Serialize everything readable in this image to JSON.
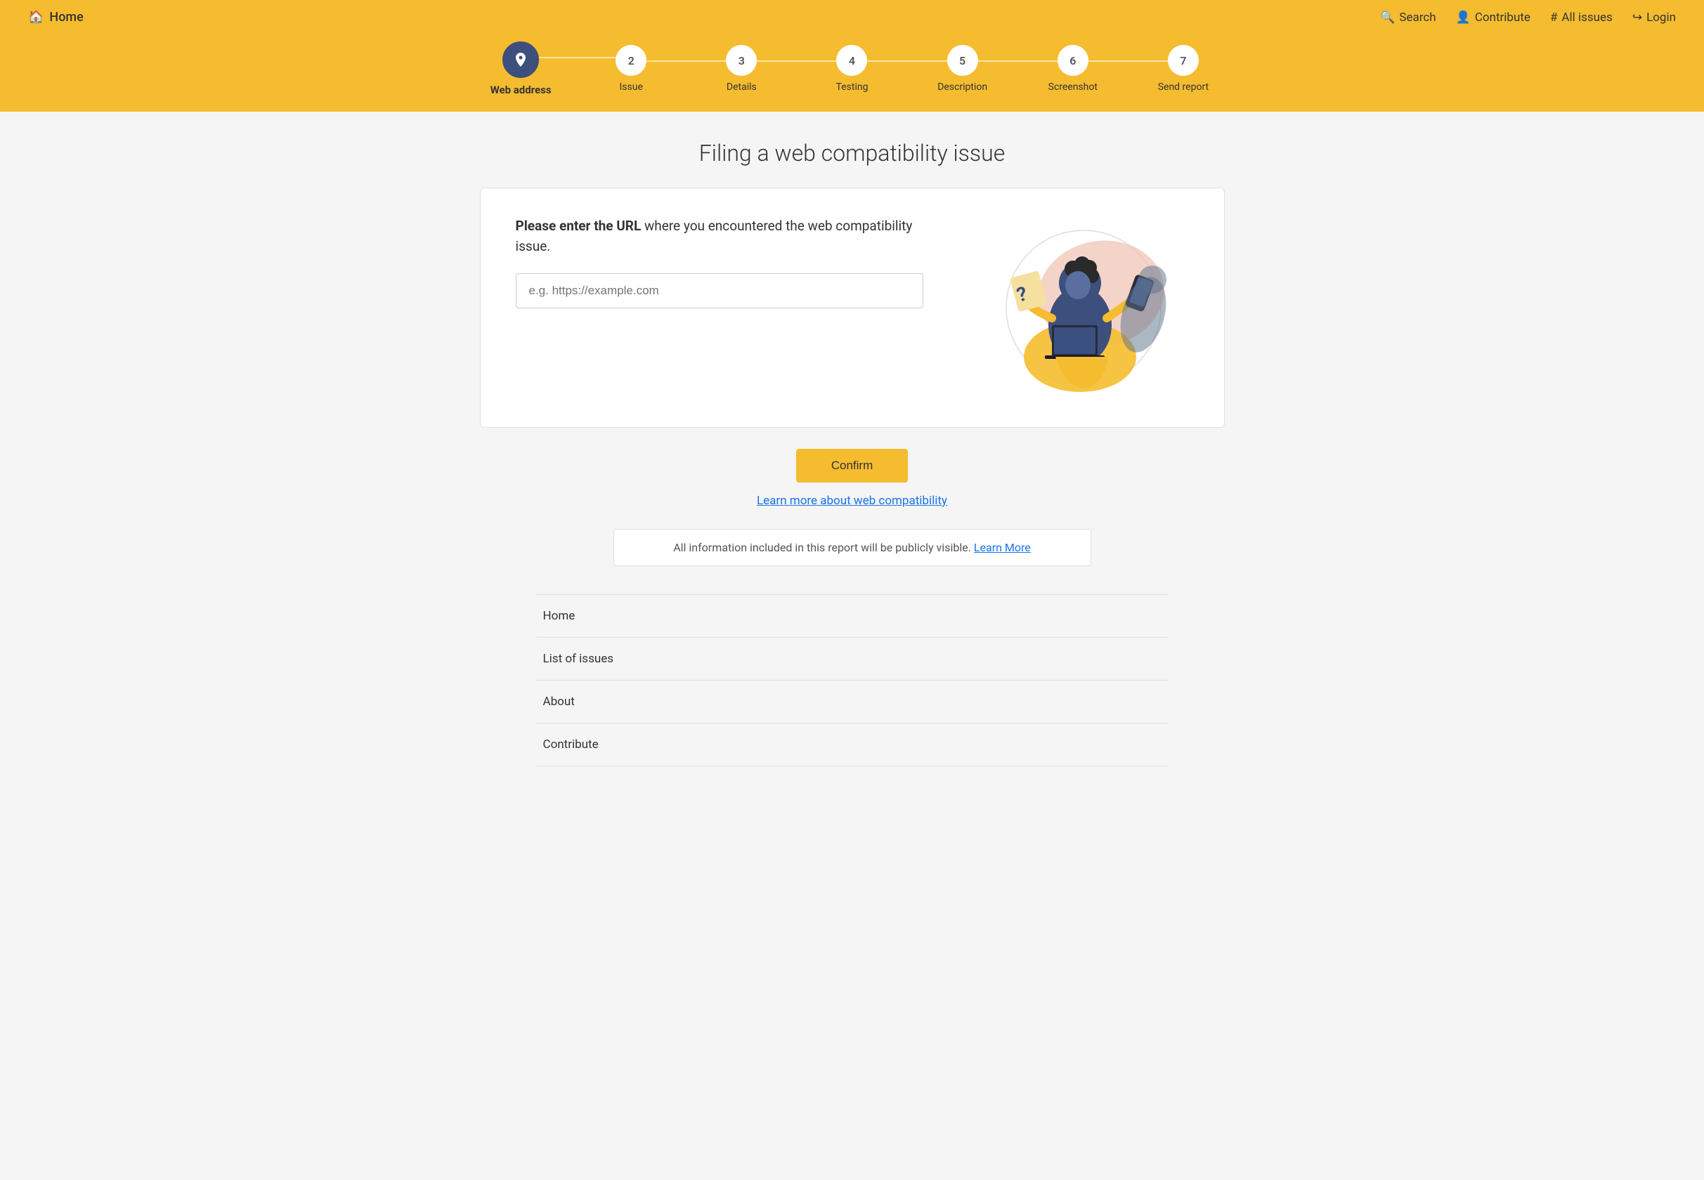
{
  "header": {
    "home_label": "Home",
    "home_icon": "🏠",
    "nav": [
      {
        "id": "search",
        "label": "Search",
        "icon": "🔍"
      },
      {
        "id": "contribute",
        "label": "Contribute",
        "icon": "👤"
      },
      {
        "id": "all_issues",
        "label": "All issues",
        "icon": "#"
      },
      {
        "id": "login",
        "label": "Login",
        "icon": "→"
      }
    ]
  },
  "stepper": {
    "steps": [
      {
        "id": "web-address",
        "number": "1",
        "label": "Web address",
        "active": true,
        "icon": "📍"
      },
      {
        "id": "issue",
        "number": "2",
        "label": "Issue",
        "active": false
      },
      {
        "id": "details",
        "number": "3",
        "label": "Details",
        "active": false
      },
      {
        "id": "testing",
        "number": "4",
        "label": "Testing",
        "active": false
      },
      {
        "id": "description",
        "number": "5",
        "label": "Description",
        "active": false
      },
      {
        "id": "screenshot",
        "number": "6",
        "label": "Screenshot",
        "active": false
      },
      {
        "id": "send-report",
        "number": "7",
        "label": "Send report",
        "active": false
      }
    ]
  },
  "main": {
    "page_title": "Filing a web compatibility issue",
    "card": {
      "prompt_bold": "Please enter the URL",
      "prompt_rest": " where you encountered the web compatibility issue.",
      "input_placeholder": "e.g. https://example.com"
    },
    "confirm_label": "Confirm",
    "learn_more_label": "Learn more about web compatibility",
    "public_notice": {
      "text": "All information included in this report will be publicly visible.",
      "link_label": "Learn More"
    }
  },
  "footer_nav": [
    {
      "id": "home",
      "label": "Home"
    },
    {
      "id": "list-of-issues",
      "label": "List of issues"
    },
    {
      "id": "about",
      "label": "About"
    },
    {
      "id": "contribute",
      "label": "Contribute"
    }
  ],
  "colors": {
    "header_bg": "#f5bc2f",
    "confirm_bg": "#f5bc2f",
    "active_step_bg": "#3d4f7c"
  }
}
